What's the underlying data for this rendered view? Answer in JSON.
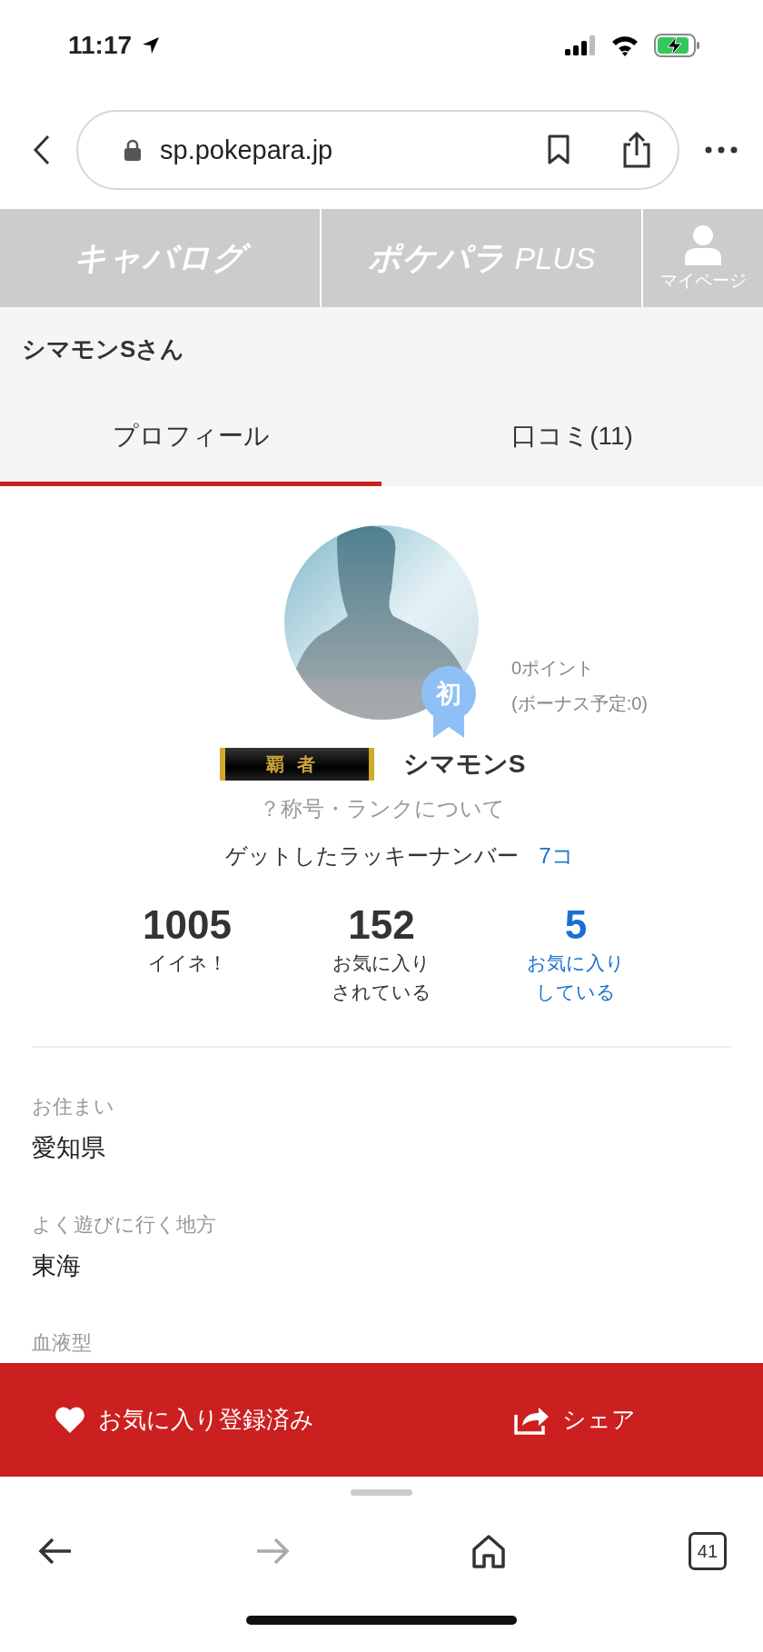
{
  "status_bar": {
    "time": "11:17"
  },
  "browser": {
    "url": "sp.pokepara.jp",
    "tab_count": "41"
  },
  "site_nav": [
    {
      "kind": "logo",
      "label": "キャバログ"
    },
    {
      "kind": "logo_plus",
      "label": "ポケパラ",
      "suffix": "PLUS"
    },
    {
      "kind": "account",
      "label": "マイページ"
    }
  ],
  "page_title": "シマモンSさん",
  "tabs": [
    {
      "label": "プロフィール",
      "selected": true
    },
    {
      "label": "口コミ(11)",
      "selected": false
    }
  ],
  "profile": {
    "rank_badge": "初",
    "points": "0ポイント",
    "bonus": "(ボーナス予定:0)",
    "title_badge": "覇者",
    "name": "シマモンS",
    "rank_help_link": "？称号・ランクについて",
    "lucky_label": "ゲットしたラッキーナンバー",
    "lucky_count": "7コ"
  },
  "stats": [
    {
      "value": "1005",
      "label_lines": [
        "イイネ！"
      ],
      "link": false
    },
    {
      "value": "152",
      "label_lines": [
        "お気に入り",
        "されている"
      ],
      "link": false
    },
    {
      "value": "5",
      "label_lines": [
        "お気に入り",
        "している"
      ],
      "link": true
    }
  ],
  "fields": [
    {
      "label": "お住まい",
      "value": "愛知県"
    },
    {
      "label": "よく遊びに行く地方",
      "value": "東海"
    },
    {
      "label": "血液型"
    }
  ],
  "action_bar": [
    {
      "kind": "favorite",
      "label": "お気に入り登録済み"
    },
    {
      "kind": "share",
      "label": "シェア"
    }
  ]
}
